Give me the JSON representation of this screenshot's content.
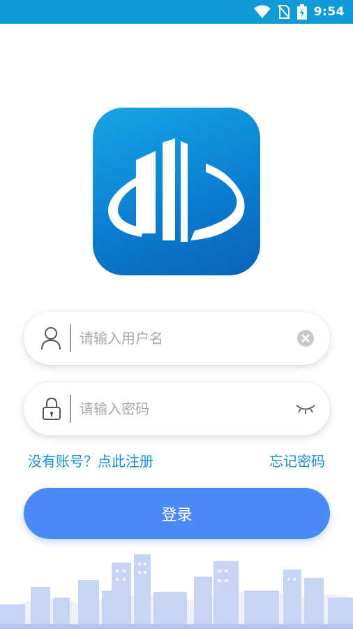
{
  "status_bar": {
    "time": "9:54"
  },
  "login": {
    "username_placeholder": "请输入用户名",
    "password_placeholder": "请输入密码",
    "register_link": "没有账号？点此注册",
    "forgot_link": "忘记密码",
    "login_button": "登录"
  },
  "colors": {
    "status_bar": "#0f9ad8",
    "accent": "#4a8af4",
    "link": "#1a8fd6"
  }
}
